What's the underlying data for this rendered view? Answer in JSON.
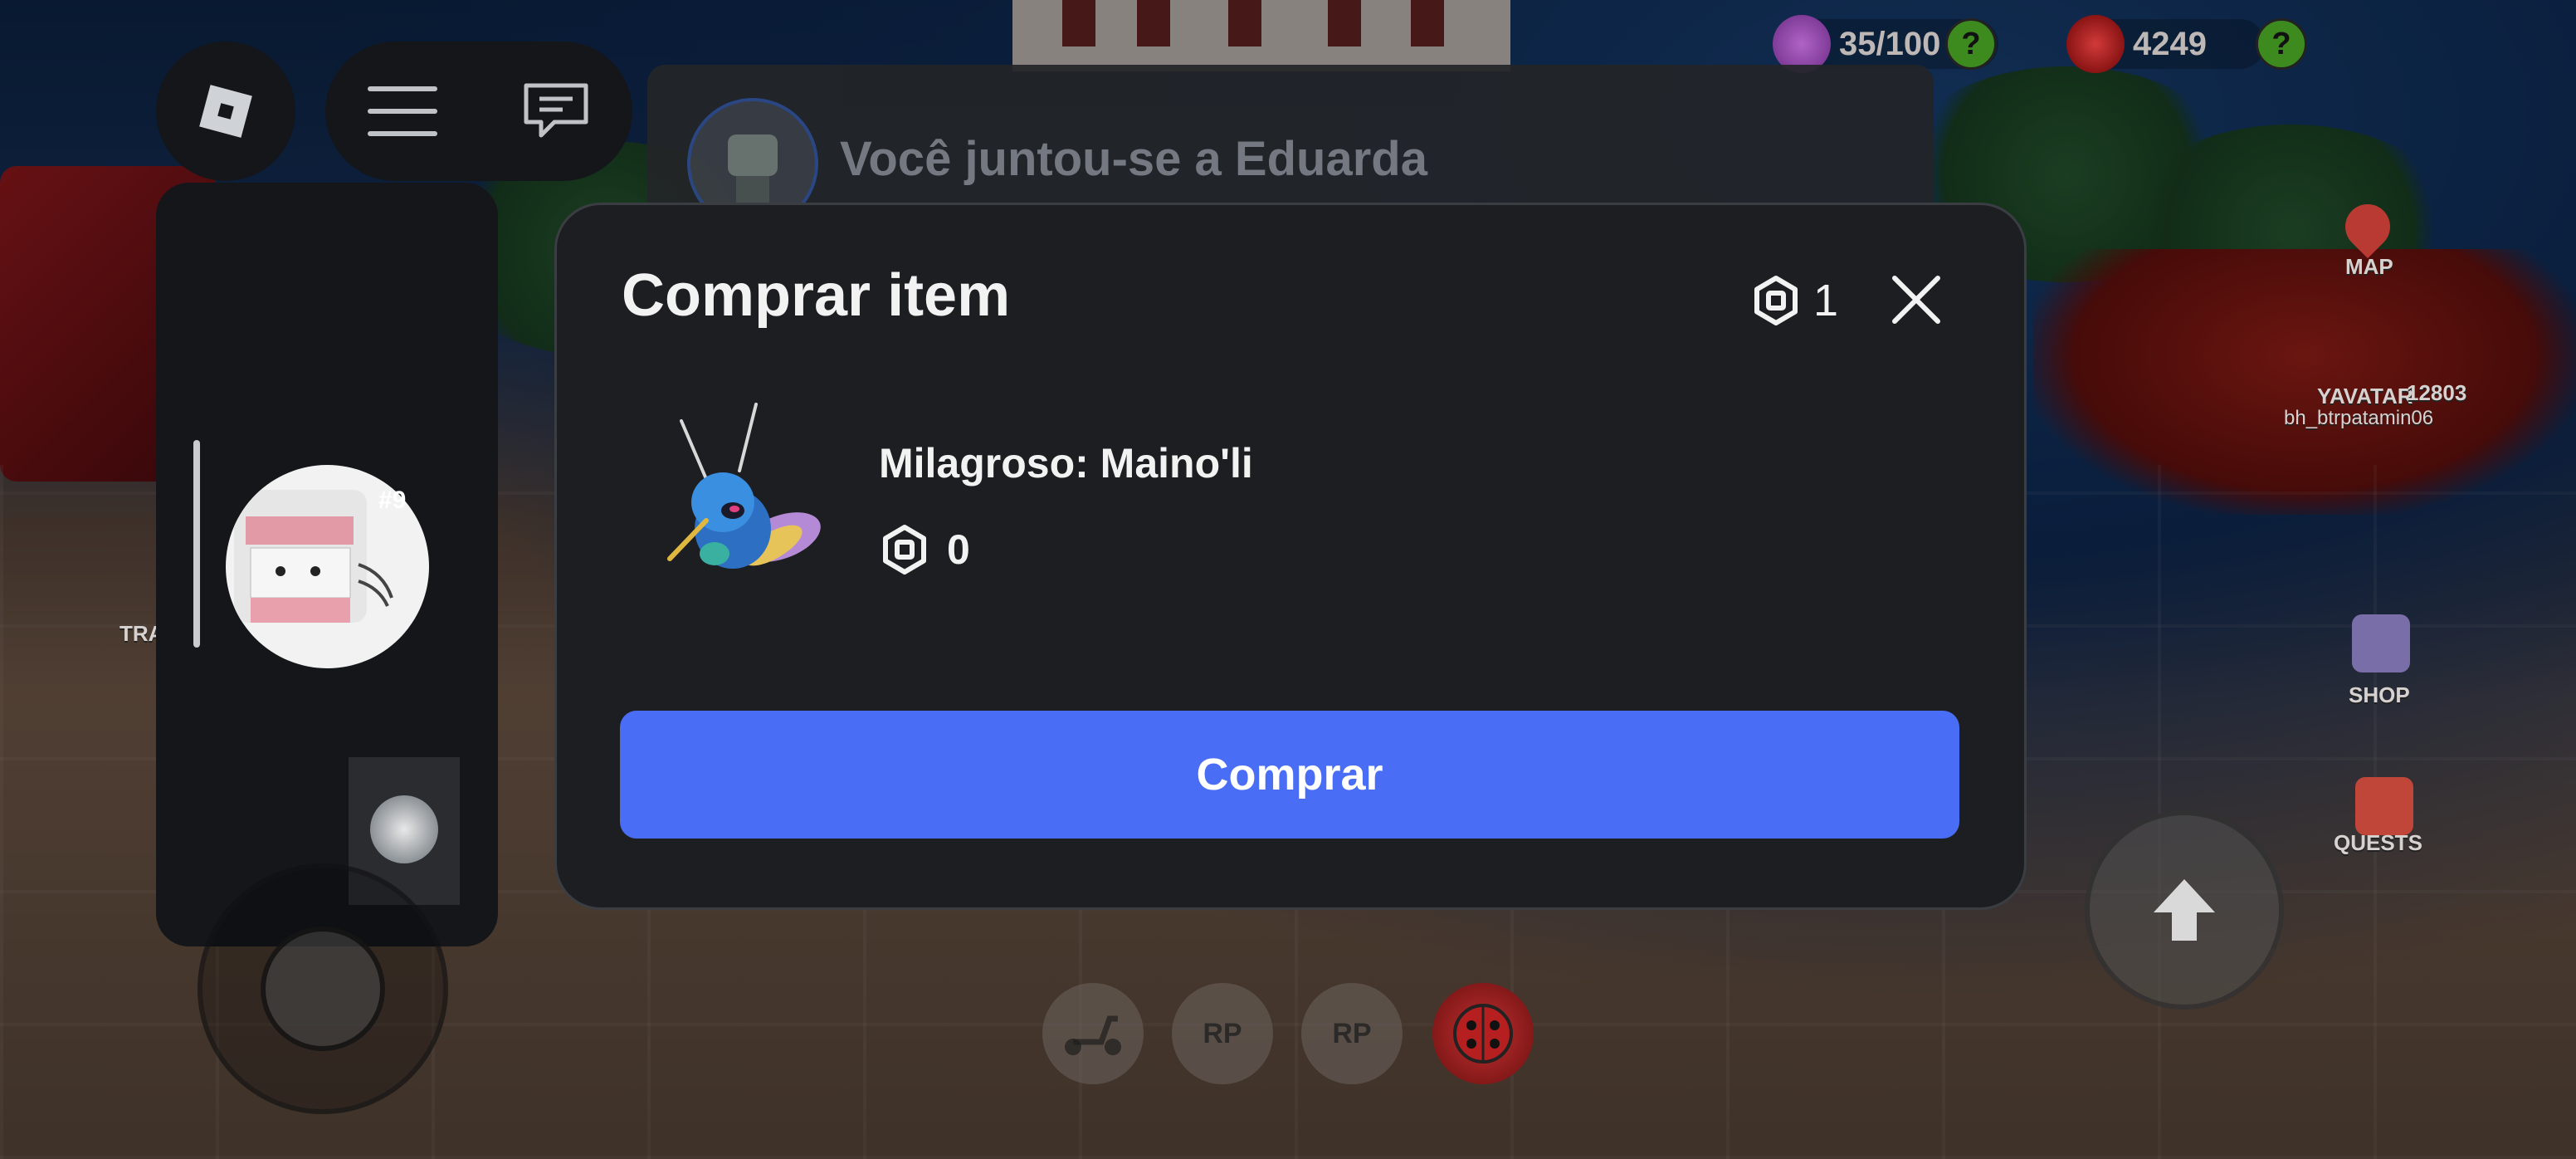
{
  "notification": {
    "text": "Você juntou-se a Eduarda"
  },
  "side_panel": {
    "user_tag": "#9"
  },
  "stats": {
    "energy": "35/100",
    "coins": "4249",
    "help_label": "?"
  },
  "side_menu": {
    "map": "MAP",
    "shop": "SHOP",
    "quests": "QUESTS",
    "avatar": "YAVATAR",
    "player_id": "12803",
    "player_name": "bh_btrpatamin06",
    "trade": "TRA"
  },
  "bottom_buttons": {
    "rp1": "RP",
    "rp2": "RP"
  },
  "modal": {
    "title": "Comprar item",
    "balance": "1",
    "item_name": "Milagroso: Maino'li",
    "price": "0",
    "buy_label": "Comprar"
  },
  "colors": {
    "buy_button": "#4a6df6",
    "modal_bg": "#1c1e21",
    "help_badge": "#3d8a1f"
  }
}
